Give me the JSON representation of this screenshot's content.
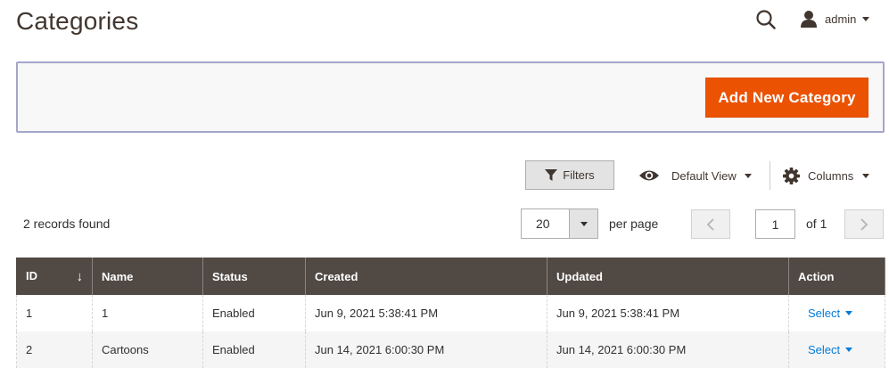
{
  "header": {
    "title": "Categories",
    "user_name": "admin"
  },
  "actions": {
    "add_new_label": "Add New Category"
  },
  "toolbar": {
    "filters_label": "Filters",
    "view_label": "Default View",
    "columns_label": "Columns"
  },
  "grid_info": {
    "records_found": "2 records found",
    "per_page_value": "20",
    "per_page_label": "per page",
    "page_current": "1",
    "page_of": "of 1"
  },
  "table": {
    "columns": [
      "ID",
      "Name",
      "Status",
      "Created",
      "Updated",
      "Action"
    ],
    "sort_indicator": "↓",
    "rows": [
      {
        "id": "1",
        "name": "1",
        "status": "Enabled",
        "created": "Jun 9, 2021 5:38:41 PM",
        "updated": "Jun 9, 2021 5:38:41 PM",
        "action": "Select"
      },
      {
        "id": "2",
        "name": "Cartoons",
        "status": "Enabled",
        "created": "Jun 14, 2021 6:00:30 PM",
        "updated": "Jun 14, 2021 6:00:30 PM",
        "action": "Select"
      }
    ]
  },
  "colors": {
    "accent": "#eb5202",
    "table_header": "#514943",
    "link": "#007bdb"
  }
}
